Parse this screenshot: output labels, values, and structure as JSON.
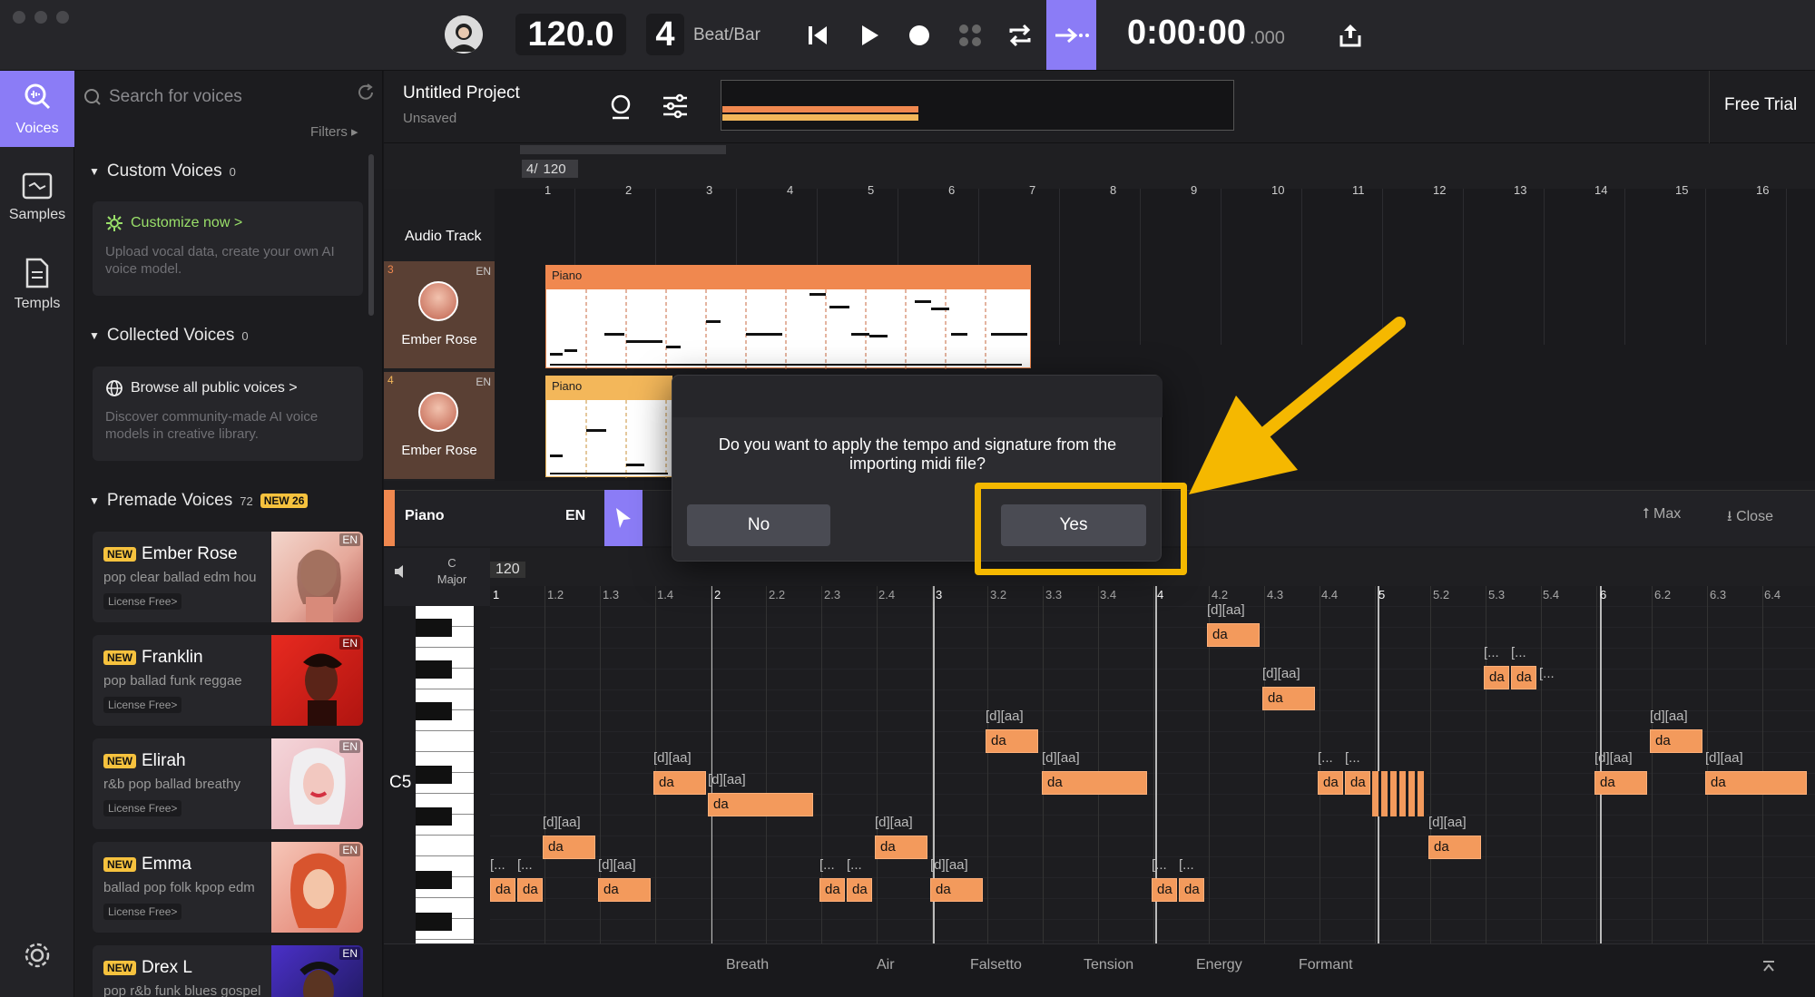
{
  "transport": {
    "tempo": "120.0",
    "beats": "4",
    "beats_label": "Beat/Bar",
    "time_main": "0:00:00",
    "time_ms": ".000"
  },
  "rail": {
    "voices": "Voices",
    "samples": "Samples",
    "templs": "Templs"
  },
  "voices_panel": {
    "search_placeholder": "Search for voices",
    "filters": "Filters",
    "custom_title": "Custom Voices",
    "custom_count": "0",
    "customize_link": "Customize now >",
    "customize_desc": "Upload vocal data, create your own AI voice model.",
    "collected_title": "Collected Voices",
    "collected_count": "0",
    "browse_link": "Browse all public voices >",
    "browse_desc": "Discover community-made AI voice models in creative library.",
    "premade_title": "Premade Voices",
    "premade_count": "72",
    "premade_new": "NEW 26",
    "new_badge": "NEW",
    "license": "License Free>",
    "en": "EN",
    "items": [
      {
        "name": "Ember Rose",
        "tags": "pop clear ballad edm hou"
      },
      {
        "name": "Franklin",
        "tags": "pop ballad funk reggae"
      },
      {
        "name": "Elirah",
        "tags": "r&b pop ballad breathy"
      },
      {
        "name": "Emma",
        "tags": "ballad pop folk kpop edm"
      },
      {
        "name": "Drex L",
        "tags": "pop r&b funk blues gospel"
      }
    ]
  },
  "project": {
    "title": "Untitled Project",
    "status": "Unsaved",
    "free_trial": "Free Trial"
  },
  "timeline": {
    "signature": "4/",
    "tempo": "120",
    "bars": [
      "1",
      "2",
      "3",
      "4",
      "5",
      "6",
      "7",
      "8",
      "9",
      "10",
      "11",
      "12",
      "13",
      "14",
      "15",
      "16"
    ],
    "audio_track": "Audio Track"
  },
  "tracks": [
    {
      "number": "3",
      "lang": "EN",
      "voice": "Ember Rose",
      "clip": "Piano"
    },
    {
      "number": "4",
      "lang": "EN",
      "voice": "Ember Rose",
      "clip": "Piano"
    }
  ],
  "editor": {
    "track_name": "Piano",
    "lang": "EN",
    "max": "Max",
    "close": "Close",
    "key": "C",
    "scale": "Major",
    "tempo": "120",
    "c5_label": "C5",
    "beats": [
      "1",
      "1.2",
      "1.3",
      "1.4",
      "2",
      "2.2",
      "2.3",
      "2.4",
      "3",
      "3.2",
      "3.3",
      "3.4",
      "4",
      "4.2",
      "4.3",
      "4.4",
      "5",
      "5.2",
      "5.3",
      "5.4",
      "6",
      "6.2",
      "6.3",
      "6.4"
    ],
    "note_text": "da",
    "lyric_text": "[d][aa]",
    "lyric_short": "[..."
  },
  "params": [
    "Breath",
    "Air",
    "Falsetto",
    "Tension",
    "Energy",
    "Formant"
  ],
  "dialog": {
    "message": "Do you want to apply the tempo and signature from the importing midi file?",
    "no": "No",
    "yes": "Yes"
  },
  "colors": {
    "accent_purple": "#8b7cf6",
    "note_orange": "#f39a5c",
    "highlight_yellow": "#f5b800",
    "link_green": "#9ae06a"
  }
}
